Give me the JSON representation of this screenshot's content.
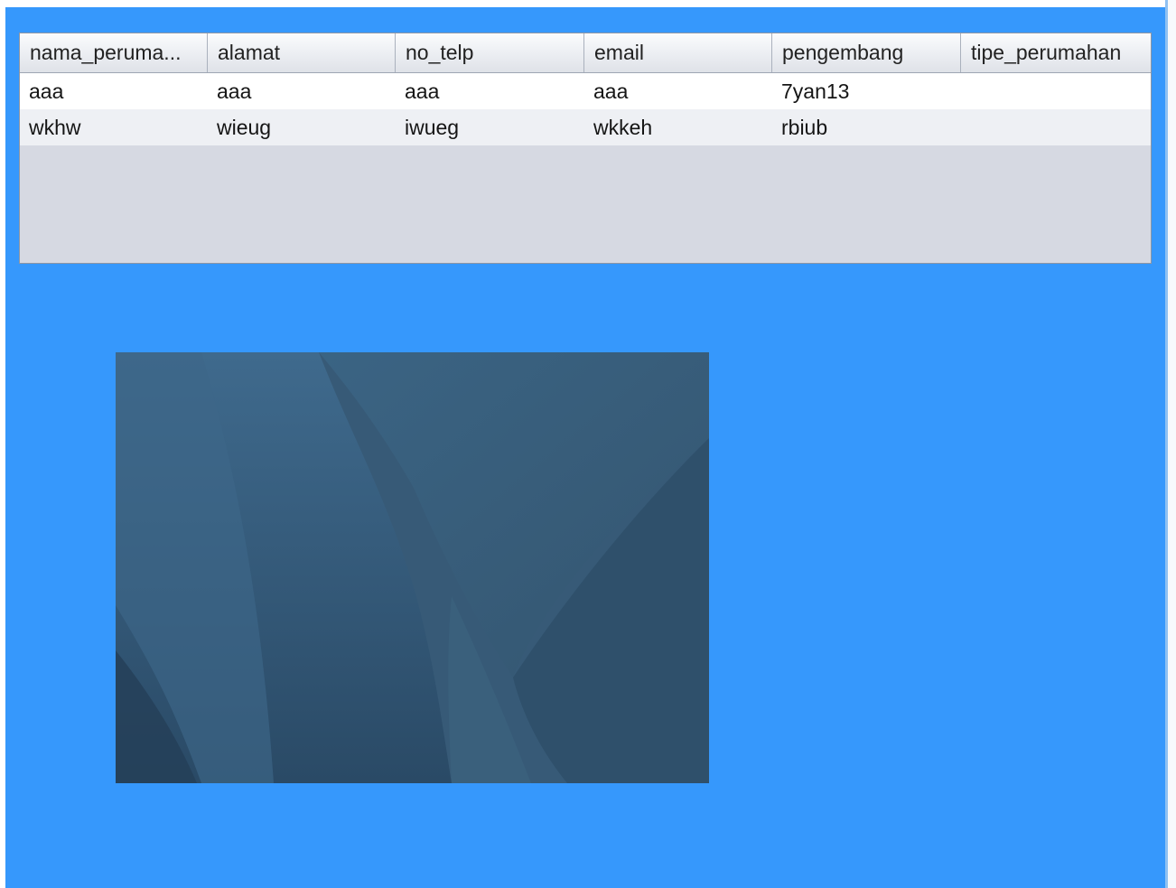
{
  "table": {
    "columns": [
      "nama_peruma...",
      "alamat",
      "no_telp",
      "email",
      "pengembang",
      "tipe_perumahan"
    ],
    "rows": [
      [
        "aaa",
        "aaa",
        "aaa",
        "aaa",
        "7yan13",
        ""
      ],
      [
        "wkhw",
        "wieug",
        "iwueg",
        "wkkeh",
        "rbiub",
        ""
      ]
    ]
  },
  "colors": {
    "panel_background": "#3698fc",
    "table_empty_area": "#d6d9e2",
    "picture_base": "#385a76"
  }
}
